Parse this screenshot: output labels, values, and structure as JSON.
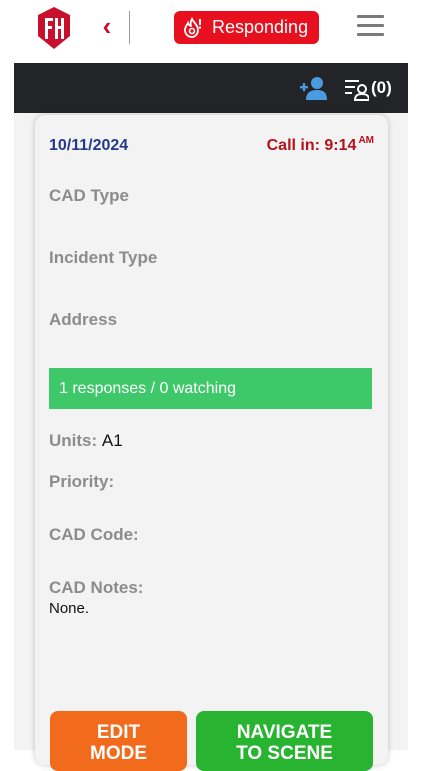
{
  "header": {
    "back_glyph": "‹",
    "responding_label": "Responding",
    "brand_color": "#c8102e",
    "responding_color": "#e8101e"
  },
  "toolbar": {
    "filter_count": "(0)",
    "icons": [
      "add-person-icon",
      "filter-list-icon"
    ]
  },
  "incident": {
    "date": "10/11/2024",
    "call_in_label": "Call in: 9:14",
    "call_in_ampm": "AM",
    "cad_type_label": "CAD Type",
    "incident_type_label": "Incident Type",
    "address_label": "Address",
    "responses_text": "1 responses / 0 watching",
    "units_label": "Units:",
    "units_value": "A1",
    "priority_label": "Priority:",
    "cad_code_label": "CAD Code:",
    "cad_notes_label": "CAD Notes:",
    "cad_notes_value": "None."
  },
  "buttons": {
    "edit_line1": "EDIT",
    "edit_line2": "MODE",
    "navigate_line1": "NAVIGATE",
    "navigate_line2": "TO SCENE"
  },
  "colors": {
    "date": "#233a8c",
    "call_in": "#b5121b",
    "responses_bar": "#3fc86a",
    "edit_button": "#f26a1b",
    "navigate_button": "#28b331",
    "dark_bar": "#222428"
  }
}
